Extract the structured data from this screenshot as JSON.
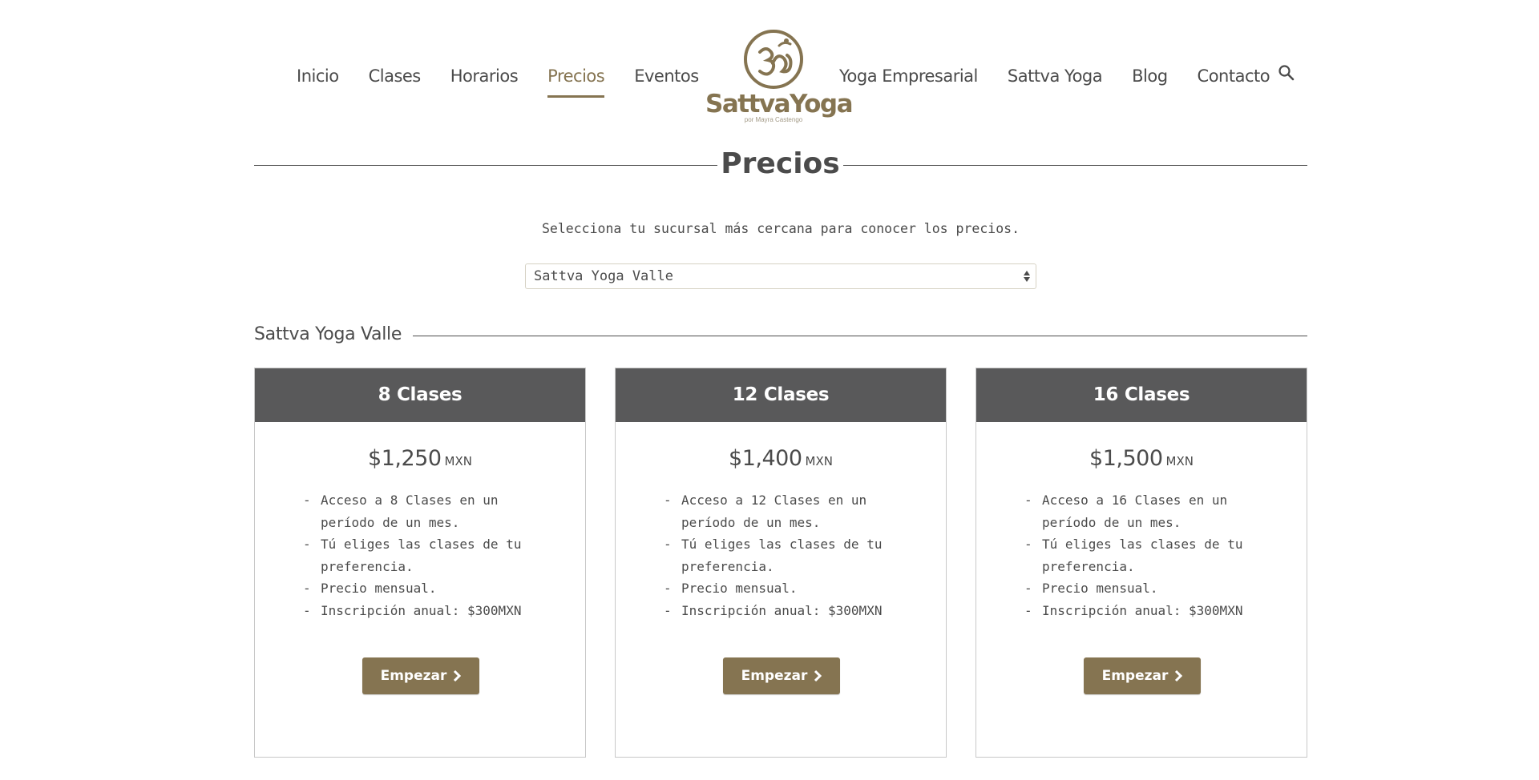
{
  "nav": {
    "left": [
      "Inicio",
      "Clases",
      "Horarios",
      "Precios",
      "Eventos"
    ],
    "right": [
      "Yoga Empresarial",
      "Sattva Yoga",
      "Blog",
      "Contacto"
    ],
    "active": "Precios",
    "search_icon": "search-icon"
  },
  "logo": {
    "name": "SattvaYoga",
    "subtitle": "por Mayra Castengo",
    "symbol": "om-icon"
  },
  "page": {
    "title": "Precios",
    "intro": "Selecciona tu sucursal más cercana para conocer los precios.",
    "branch_select_value": "Sattva Yoga Valle",
    "branch_heading": "Sattva Yoga Valle"
  },
  "plans": [
    {
      "name": "8 Clases",
      "price": "$1,250",
      "currency": "MXN",
      "features": [
        "Acceso a 8 Clases en un período de un mes.",
        "Tú eliges las clases de tu preferencia.",
        "Precio mensual.",
        "Inscripción anual: $300MXN"
      ],
      "button": "Empezar"
    },
    {
      "name": "12 Clases",
      "price": "$1,400",
      "currency": "MXN",
      "features": [
        "Acceso a 12 Clases en un período de un mes.",
        "Tú eliges las clases de tu preferencia.",
        "Precio mensual.",
        "Inscripción anual: $300MXN"
      ],
      "button": "Empezar"
    },
    {
      "name": "16 Clases",
      "price": "$1,500",
      "currency": "MXN",
      "features": [
        "Acceso a 16 Clases en un período de un mes.",
        "Tú eliges las clases de tu preferencia.",
        "Precio mensual.",
        "Inscripción anual: $300MXN"
      ],
      "button": "Empezar"
    }
  ],
  "colors": {
    "brand": "#857451",
    "card_header": "#59595a",
    "text": "#4b4b4b"
  }
}
